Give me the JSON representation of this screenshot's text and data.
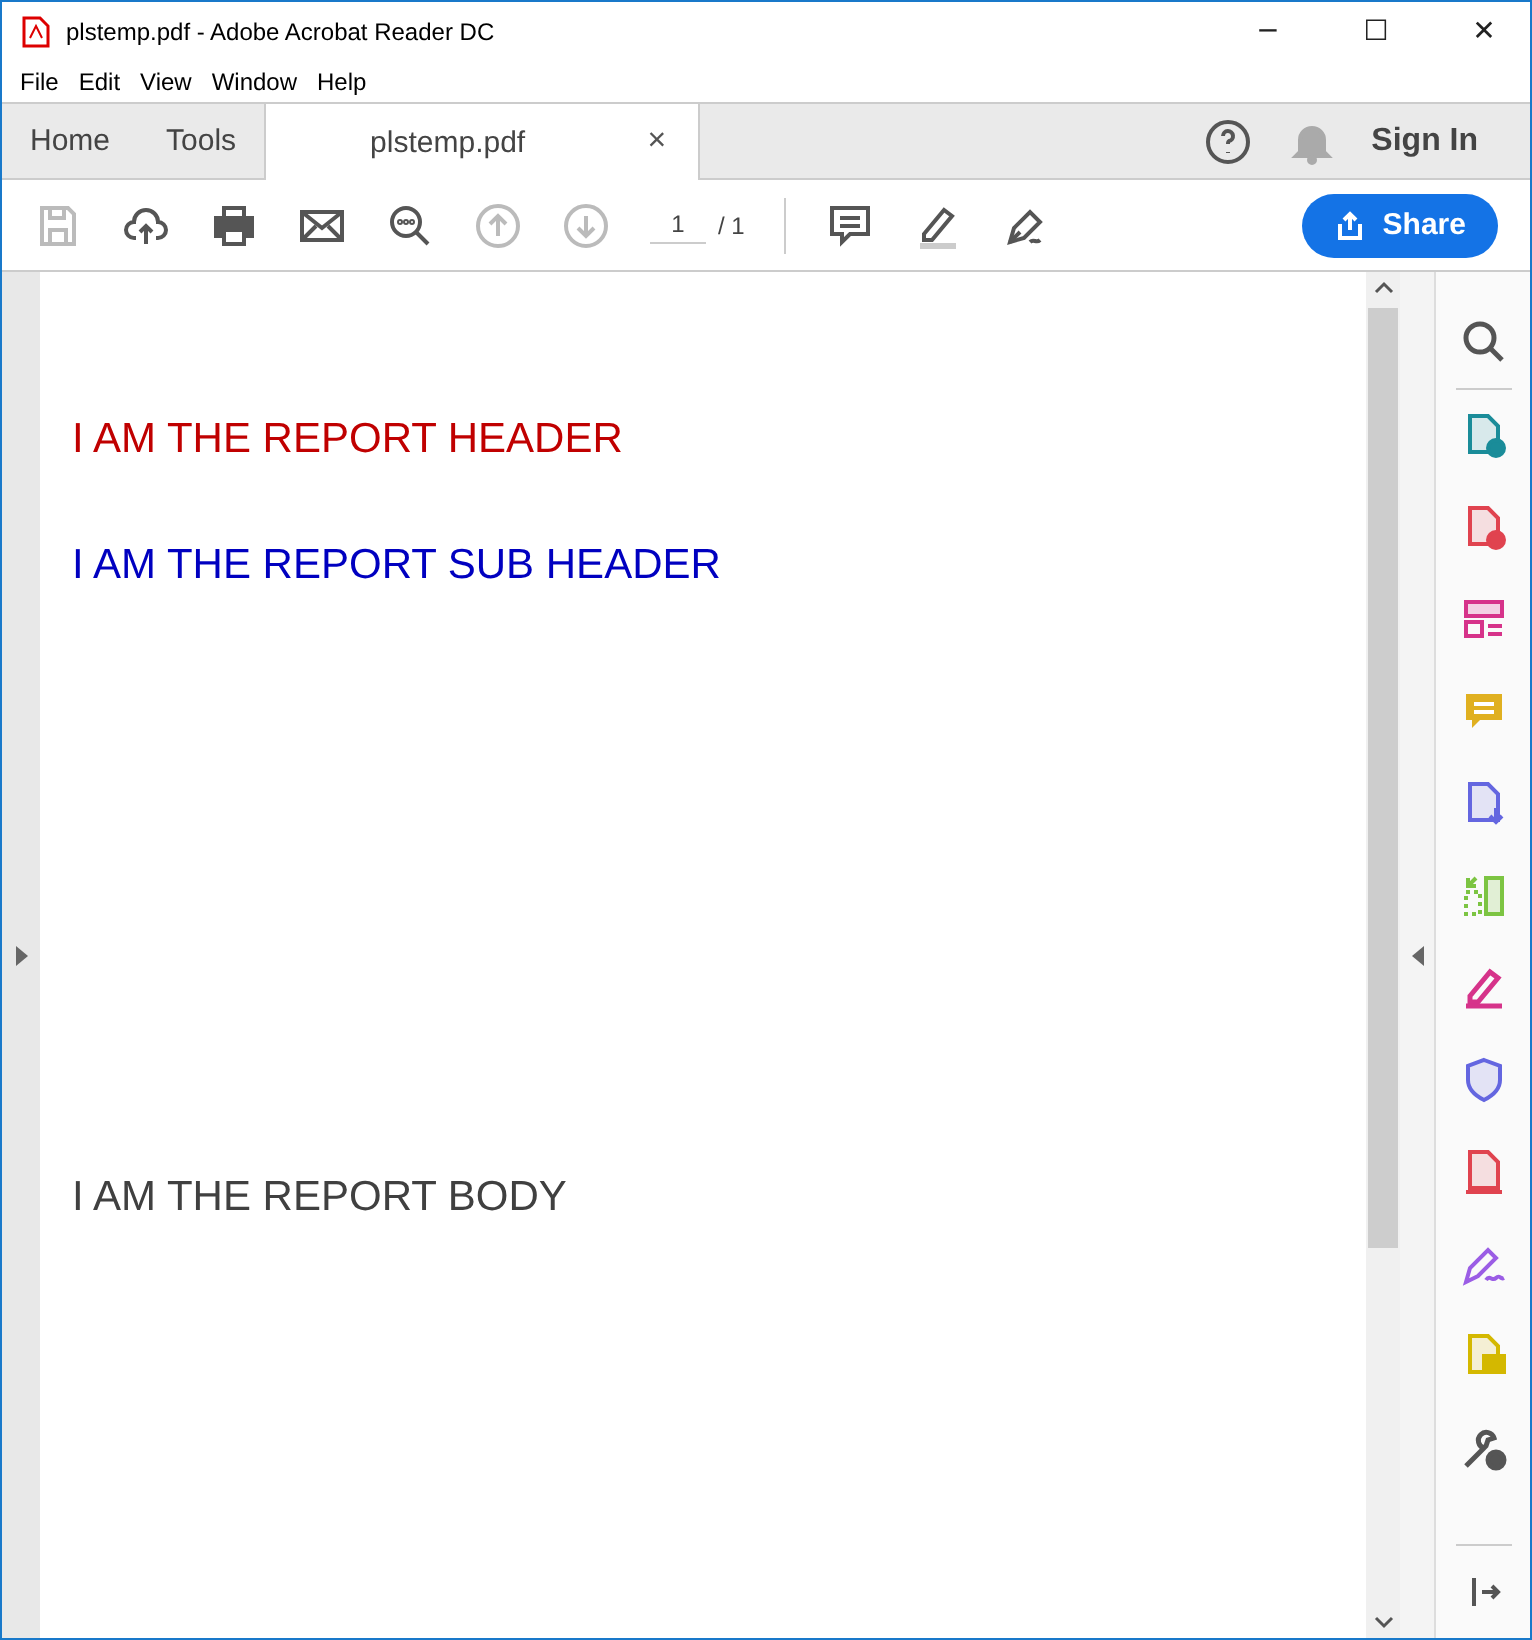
{
  "window": {
    "title": "plstemp.pdf - Adobe Acrobat Reader DC",
    "controls": [
      "─",
      "☐",
      "✕"
    ]
  },
  "menu": [
    "File",
    "Edit",
    "View",
    "Window",
    "Help"
  ],
  "tabs": [
    {
      "label": "Home",
      "selected": false
    },
    {
      "label": "Tools",
      "selected": false
    },
    {
      "label": "plstemp.pdf",
      "selected": true,
      "close": "×"
    }
  ],
  "account": {
    "sign_in": "Sign In"
  },
  "toolbar": {
    "page_value": "1",
    "page_total": "/ 1",
    "share": "Share"
  },
  "document": {
    "lines": [
      {
        "text": "I AM THE REPORT HEADER",
        "color": "#c00000"
      },
      {
        "text": "I AM THE REPORT SUB HEADER",
        "color": "#0000c0"
      },
      {
        "text": "I AM THE REPORT BODY",
        "color": "#404040"
      }
    ]
  }
}
